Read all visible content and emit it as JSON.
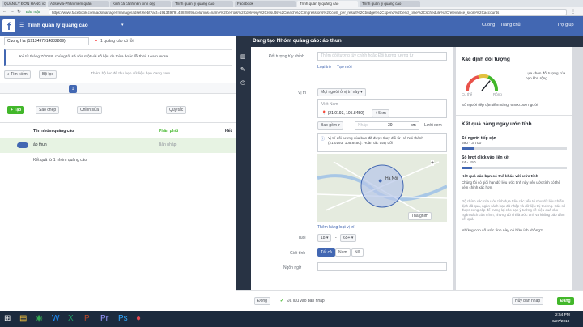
{
  "browser": {
    "tabs": [
      {
        "label": "QUẢN LÝ ĐƠN HÀNG v2",
        "active": false
      },
      {
        "label": "Adslevia-Phần mềm quản",
        "active": false
      },
      {
        "label": "Kinh cả cảnh nền xinh đẹp",
        "active": false
      },
      {
        "label": "Trình quản lý quảng cáo",
        "active": false
      },
      {
        "label": "Facebook",
        "active": false
      },
      {
        "label": "Trình quản lý quảng cáo",
        "active": true
      },
      {
        "label": "Trình quản lý quảng cáo",
        "active": false
      }
    ],
    "back_label": "Bảo mật",
    "url": "https://www.facebook.com/adsmanager/manage/adsets/edit?act=1913497914882809&columns=name%2Cerrors%2Cdelivery%2Cresults%2Creach%2Cimpressions%2Ccost_per_result%2Cbudget%2Cspend%2Cend_time%2Cschedule%2Crelevance_score%2Caccounts"
  },
  "fb": {
    "app_title": "Trình quản lý quảng cáo",
    "user_name": "Cuong",
    "home_label": "Trang chủ",
    "help_label": "Trợ giúp",
    "logo": "f"
  },
  "left": {
    "account_select": "Cuong Ha (1913497914882809)",
    "error_badge": "1 quảng cáo có lỗi",
    "notice": "Kể từ tháng 7/2018, chúng tôi sẽ xóa một vài số liệu do thừa hoặc lỗi thời. Learn more",
    "search_label": "Tìm kiếm",
    "filter_label": "Bộ lọc",
    "filter_hint": "Thêm bộ lọc để thu hẹp dữ liệu bạn đang xem",
    "create_label": "+ Tạo",
    "copy_label": "Sao chép",
    "edit_label": "Chỉnh sửa",
    "rules_label": "Quy tắc",
    "col_name": "Tên nhóm quảng cáo",
    "col_delivery": "Phân phối",
    "col_result": "Kết",
    "row_name": "áo thun",
    "row_delivery": "Bản nháp",
    "results_summary": "Kết quả từ 1 nhóm quảng cáo"
  },
  "modal": {
    "title": "Đang tạo Nhóm quảng cáo: áo thun",
    "custom_audience_label": "Đối tượng tùy chỉnh",
    "custom_audience_placeholder": "Thêm đối tượng tùy chỉnh hoặc Đối tượng tương tự",
    "exclude_label": "Loại trừ",
    "create_new_label": "Tạo mới",
    "location_label": "Vị trí",
    "location_select": "Mọi người ở vị trí này",
    "country": "Việt Nam",
    "pin_coords": "(21.0193, 105.8450)",
    "radius_select": "+ 5km",
    "include_select": "Bao gồm",
    "radius_input_placeholder": "Nhập",
    "radius_value": "30",
    "radius_unit": "km",
    "browse_label": "Lướt xem",
    "warning_text": "Vị trí đối tượng của bạn đã được thay đổi từ Hà Nội thành (21.0193, 105.8450). Hoàn tác thay đổi",
    "map_city": "Hà Nội",
    "drop_pin": "Thả ghim",
    "add_bulk": "Thêm hàng loạt vị trí",
    "age_label": "Tuổi",
    "age_min": "18",
    "age_max": "65+",
    "gender_label": "Giới tính",
    "gender_all": "Tất cả",
    "gender_male": "Nam",
    "gender_female": "Nữ",
    "language_label": "Ngôn ngữ"
  },
  "right": {
    "audience_title": "Xác định đối tượng",
    "audience_desc": "Lựa chọn đối tượng của bạn khá rộng",
    "gauge_specific": "Cụ thể",
    "gauge_broad": "Rộng",
    "gauge_level": 0.72,
    "potential_reach": "Số người tiếp cận tiềm năng: 6.800.000 người",
    "daily_title": "Kết quả hàng ngày ước tính",
    "reach_label": "Số người tiếp cận",
    "reach_value": "590 - 3.700",
    "reach_fill": 0.12,
    "clicks_label": "Số lượt click vào liên kết",
    "clicks_value": "24 - 150",
    "clicks_fill": 0.1,
    "result_note_title": "Kết quả của bạn có thể khác với ước tính",
    "result_note": "Chúng tôi có giới hạn dữ liệu ước tính này nên ước tính có thể kém chính xác hơn.",
    "accuracy_note": "Độ chính xác của ước tính dựa trên các yếu tố như dữ liệu chiến dịch đã qua, ngân sách bạn đã nhập và dữ liệu thị trường. Các số được cung cấp để mang lại cho bạn ý tưởng về hiệu quả cho ngân sách của mình, nhưng đó chỉ là ước tính và không bảo đảm kết quả.",
    "helpful_q": "Những con số ước tính này có hữu ích không?"
  },
  "footer": {
    "close_label": "Đóng",
    "saved_label": "Đã lưu vào bản nháp",
    "discard_label": "Hủy bản nháp",
    "publish_label": "Đăng"
  },
  "taskbar": {
    "time": "2:54 PM",
    "date": "6/27/2018"
  },
  "colors": {
    "fb_blue": "#4267b2",
    "green": "#42b72a",
    "dark": "#283344"
  }
}
